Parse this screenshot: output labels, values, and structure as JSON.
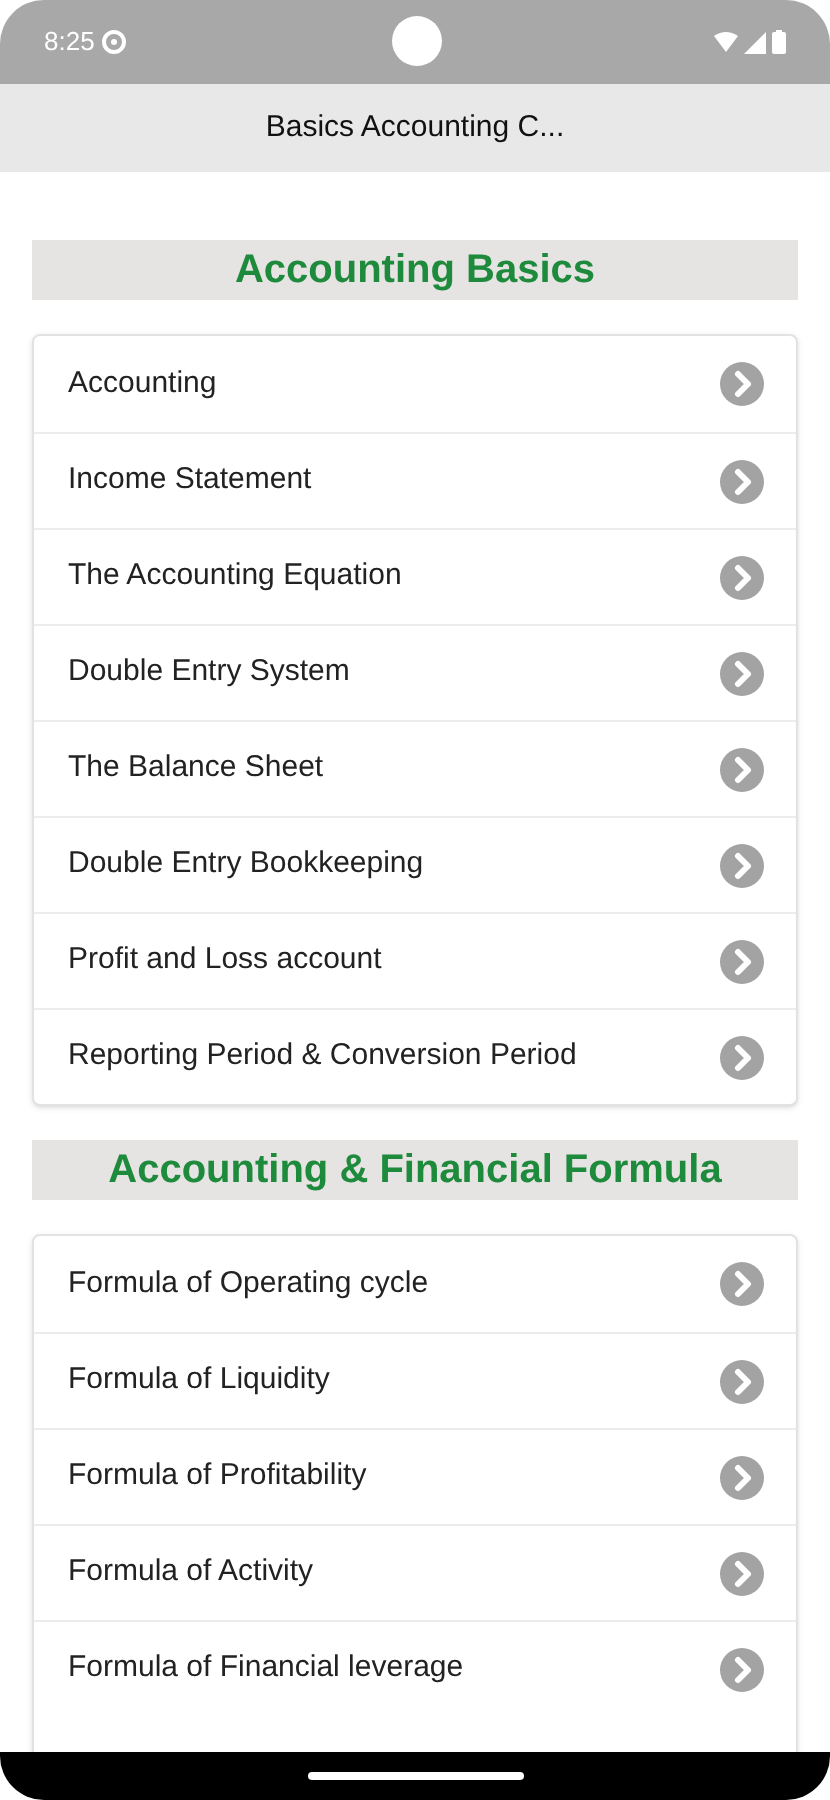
{
  "status_bar": {
    "time": "8:25"
  },
  "app_bar": {
    "title": "Basics Accounting C..."
  },
  "sections": [
    {
      "title": "Accounting Basics",
      "items": [
        {
          "label": "Accounting"
        },
        {
          "label": "Income Statement"
        },
        {
          "label": "The Accounting Equation"
        },
        {
          "label": "Double Entry System"
        },
        {
          "label": "The Balance Sheet"
        },
        {
          "label": "Double Entry Bookkeeping"
        },
        {
          "label": "Profit and Loss account"
        },
        {
          "label": "Reporting Period & Conversion Period"
        }
      ]
    },
    {
      "title": "Accounting & Financial Formula",
      "items": [
        {
          "label": "Formula of Operating cycle"
        },
        {
          "label": "Formula of Liquidity"
        },
        {
          "label": "Formula of Profitability"
        },
        {
          "label": "Formula of Activity"
        },
        {
          "label": "Formula of Financial leverage"
        }
      ]
    }
  ]
}
